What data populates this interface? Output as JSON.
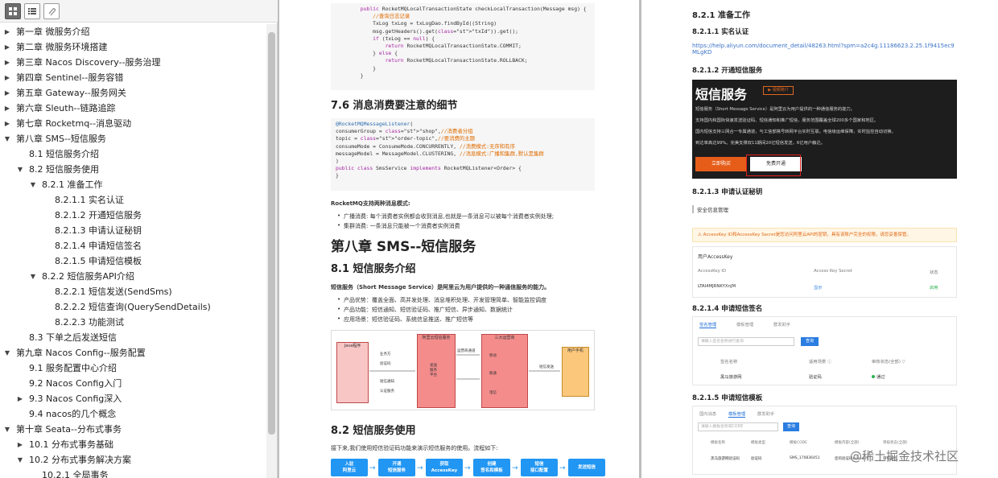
{
  "toc": [
    {
      "label": "第一章 微服务介绍",
      "level": 0,
      "twisty": "right"
    },
    {
      "label": "第二章 微服务环境搭建",
      "level": 0,
      "twisty": "right"
    },
    {
      "label": "第三章 Nacos Discovery--服务治理",
      "level": 0,
      "twisty": "right"
    },
    {
      "label": "第四章 Sentinel--服务容错",
      "level": 0,
      "twisty": "right"
    },
    {
      "label": "第五章 Gateway--服务网关",
      "level": 0,
      "twisty": "right"
    },
    {
      "label": "第六章 Sleuth--链路追踪",
      "level": 0,
      "twisty": "right"
    },
    {
      "label": "第七章 Rocketmq--消息驱动",
      "level": 0,
      "twisty": "right"
    },
    {
      "label": "第八章 SMS--短信服务",
      "level": 0,
      "twisty": "down"
    },
    {
      "label": "8.1 短信服务介绍",
      "level": 1,
      "twisty": ""
    },
    {
      "label": "8.2 短信服务使用",
      "level": 1,
      "twisty": "down"
    },
    {
      "label": "8.2.1 准备工作",
      "level": 2,
      "twisty": "down"
    },
    {
      "label": "8.2.1.1 实名认证",
      "level": 3,
      "twisty": ""
    },
    {
      "label": "8.2.1.2 开通短信服务",
      "level": 3,
      "twisty": ""
    },
    {
      "label": "8.2.1.3 申请认证秘钥",
      "level": 3,
      "twisty": ""
    },
    {
      "label": "8.2.1.4 申请短信签名",
      "level": 3,
      "twisty": ""
    },
    {
      "label": "8.2.1.5 申请短信模板",
      "level": 3,
      "twisty": ""
    },
    {
      "label": "8.2.2 短信服务API介绍",
      "level": 2,
      "twisty": "down"
    },
    {
      "label": "8.2.2.1 短信发送(SendSms)",
      "level": 3,
      "twisty": ""
    },
    {
      "label": "8.2.2.2 短信查询(QuerySendDetails)",
      "level": 3,
      "twisty": ""
    },
    {
      "label": "8.2.2.3 功能测试",
      "level": 3,
      "twisty": ""
    },
    {
      "label": "8.3 下单之后发送短信",
      "level": 1,
      "twisty": ""
    },
    {
      "label": "第九章 Nacos Config--服务配置",
      "level": 0,
      "twisty": "down"
    },
    {
      "label": "9.1 服务配置中心介绍",
      "level": 1,
      "twisty": ""
    },
    {
      "label": "9.2 Nacos Config入门",
      "level": 1,
      "twisty": ""
    },
    {
      "label": "9.3 Nacos Config深入",
      "level": 1,
      "twisty": "right"
    },
    {
      "label": "9.4 nacos的几个概念",
      "level": 1,
      "twisty": ""
    },
    {
      "label": "第十章 Seata--分布式事务",
      "level": 0,
      "twisty": "down"
    },
    {
      "label": "10.1 分布式事务基础",
      "level": 1,
      "twisty": "right"
    },
    {
      "label": "10.2 分布式事务解决方案",
      "level": 1,
      "twisty": "down"
    },
    {
      "label": "10.2.1 全局事务",
      "level": 2,
      "twisty": ""
    }
  ],
  "left_page": {
    "code1": [
      "public RocketMQLocalTransactionState checkLocalTransaction(Message msg) {",
      "    //查询日志记录",
      "    TxLog txLog = txLogDao.findById((String)",
      "    msg.getHeaders().get(\"txId\")).get();",
      "    if (txLog == null) {",
      "        return RocketMQLocalTransactionState.COMMIT;",
      "    } else {",
      "        return RocketMQLocalTransactionState.ROLLBACK;",
      "    }",
      "}"
    ],
    "h_76": "7.6 消息消费要注意的细节",
    "code2": [
      "@RocketMQMessageListener(",
      "consumerGroup = \"shop\",//消费者分组",
      "topic = \"order-topic\",//要消费的主题",
      "consumeMode = ConsumeMode.CONCURRENTLY, //消费模式:无序和有序",
      "messageModel = MessageModel.CLUSTERING, //消息模式:广播和集群,默认是集群",
      ")",
      "public class SmsService implements RocketMQListener<Order> {",
      "}"
    ],
    "consume_modes_title": "RocketMQ支持两种消息模式:",
    "consume_modes": [
      "广播消费: 每个消费者实例都会收到消息,也就是一条消息可以被每个消费者实例处理;",
      "集群消费: 一条消息只能被一个消费者实例消费"
    ],
    "h_ch8": "第八章 SMS--短信服务",
    "h_81": "8.1 短信服务介绍",
    "sms_intro": "短信服务（Short Message Service）是阿里云为用户提供的一种通信服务的能力。",
    "sms_points": [
      "产品优势：覆盖全面、高并发处理、消息堆积处理、开发管理简单、智能监控调度",
      "产品功能：短信通知、短信验证码、推广短信、异步通知、数据统计",
      "应用场景：短信验证码、系统信息推送、推广短信等"
    ],
    "diagram": {
      "left_box": "Java程序",
      "left_labels": [
        "业务方",
        "验证码",
        "短信通知",
        "认证服务"
      ],
      "mid_box": "阿里云短信服务",
      "mid_inner": "发送\n服务\n平台",
      "mid_label": "运营商通道",
      "right_box": "三大运营商",
      "right_items": [
        "移动",
        "联通",
        "电信"
      ],
      "right_label": "短信发送",
      "phone_box": "用户手机"
    },
    "h_82": "8.2 短信服务使用",
    "usage_text": "接下来,我们使用短信验证码功能来演示短信服务的使用。流程如下:",
    "flow": [
      "入驻\n阿里云",
      "开通\n短信服务",
      "获取\nAccessKey",
      "创建\n签名和模板",
      "短信\n接口配置",
      "发送短信"
    ]
  },
  "right_page": {
    "h_821": "8.2.1 准备工作",
    "h_8211": "8.2.1.1 实名认证",
    "link": "https://help.aliyun.com/document_detail/48263.html?spm=a2c4g.11186623.2.25.1f9415ec9MLgKD",
    "h_8212": "8.2.1.2 开通短信服务",
    "banner": {
      "title": "短信服务",
      "badge": "▶ 视频简介",
      "lines": [
        "短信服务（Short Message Service）是阿里云为用户提供的一种通信服务的能力。",
        "支持国内和国际快速发送验证码、短信通知和推广短信，服务范围覆盖全球200多个国家和地区。",
        "国内短信支持三网合一专属通道，与工信部携号转网平台实时互联。电信级运维保障，实时监控自动切换，",
        "到达率高达99%。完美支撑双11期间20亿短信发送，6亿用户触达。"
      ],
      "buy": "立即购买",
      "free": "免费开通"
    },
    "h_8213": "8.2.1.3 申请认证秘钥",
    "safety": "安全信息管理",
    "warn": "⚠ AccessKey ID和AccessKey Secret是您访问阿里云API的密钥，具有该账户完全的权限，请您妥善保管。",
    "ak_title": "用户AccessKey",
    "ak_headers": [
      "AccessKey ID",
      "Access Key Secret",
      "状态"
    ],
    "ak_row": [
      "LTAI4MJRNKYXnJM",
      "显示",
      "启用"
    ],
    "h_8214": "8.2.1.4 申请短信签名",
    "sig_tabs": [
      "签名管理",
      "模板管理",
      "群发助手"
    ],
    "sig_search_placeholder": "请输入签名名称进行查询",
    "sig_search_btn": "查询",
    "sig_headers": [
      "签名名称",
      "适用场景 ⓘ",
      "审核状态(全部) ▽"
    ],
    "sig_row": [
      "黑马旅游网",
      "验证码",
      "通过"
    ],
    "h_8215": "8.2.1.5 申请短信模板",
    "tpl_tabs": [
      "国内消息",
      "模板管理",
      "群发助手"
    ],
    "tpl_search_placeholder": "请输入模板名称或CODE",
    "tpl_search_btn": "查询",
    "tpl_headers": [
      "模板名称",
      "模板类型",
      "模板CODE",
      "模板内容(全部)",
      "审核状态(全部)"
    ],
    "tpl_row": [
      "黑马旅游网验证码",
      "验证码",
      "SMS_170836451",
      "您的验证码${code}...",
      "审核通过"
    ],
    "watermark": "@稀土掘金技术社区"
  }
}
